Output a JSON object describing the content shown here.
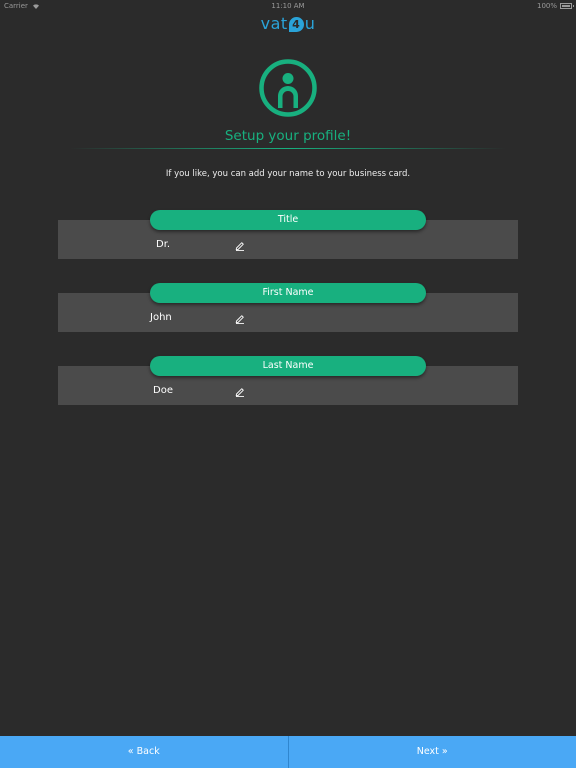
{
  "status_bar": {
    "carrier": "Carrier",
    "time": "11:10 AM",
    "battery": "100%"
  },
  "logo": {
    "prefix": "vat",
    "mark": "4",
    "suffix": "u"
  },
  "header": {
    "title": "Setup your profile!",
    "intro": "If you like, you can add your name to your business card."
  },
  "fields": [
    {
      "label": "Title",
      "value": "Dr."
    },
    {
      "label": "First Name",
      "value": "John"
    },
    {
      "label": "Last Name",
      "value": "Doe"
    }
  ],
  "footer": {
    "back_label": "« Back",
    "next_label": "Next »"
  },
  "colors": {
    "background": "#2b2b2b",
    "accent": "#18b07f",
    "field_panel": "#4b4b4b",
    "footer": "#4aa8f5",
    "logo": "#2aa3d8"
  },
  "icons": {
    "profile": "user-circle-icon",
    "edit": "pencil-icon",
    "wifi": "wifi-icon",
    "battery": "battery-icon"
  }
}
